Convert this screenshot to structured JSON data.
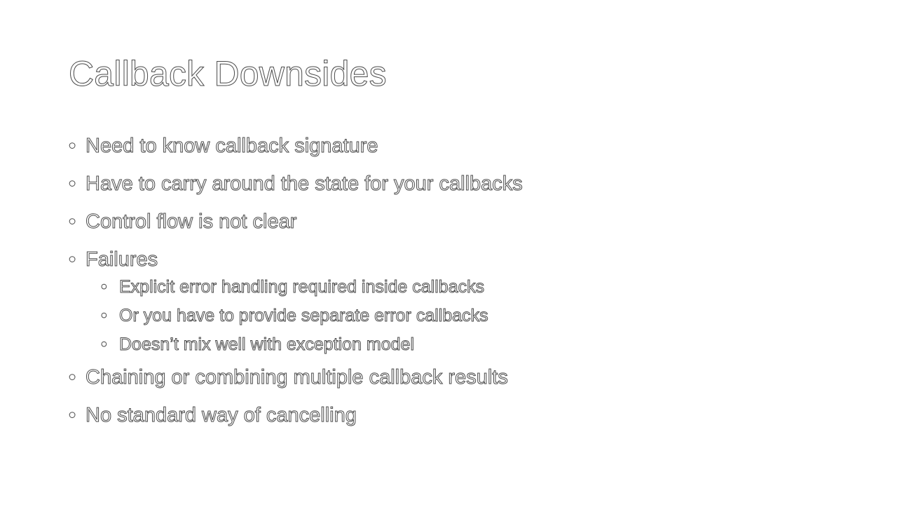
{
  "slide": {
    "title": "Callback Downsides",
    "bullet_glyph": "•",
    "items": [
      {
        "text": "Need to know callback signature"
      },
      {
        "text": "Have to carry around the state for your callbacks"
      },
      {
        "text": "Control flow is not clear"
      },
      {
        "text": "Failures"
      },
      {
        "text": "Explicit error handling required inside callbacks"
      },
      {
        "text": "Or you have to provide separate error callbacks"
      },
      {
        "text": "Doesn’t mix well with exception model"
      },
      {
        "text": "Chaining or combining multiple callback results"
      },
      {
        "text": "No standard way of cancelling"
      }
    ]
  },
  "colors": {
    "background": "#ffffff",
    "text_fill": "#ffffff",
    "text_outline": "#4a4a4a"
  }
}
